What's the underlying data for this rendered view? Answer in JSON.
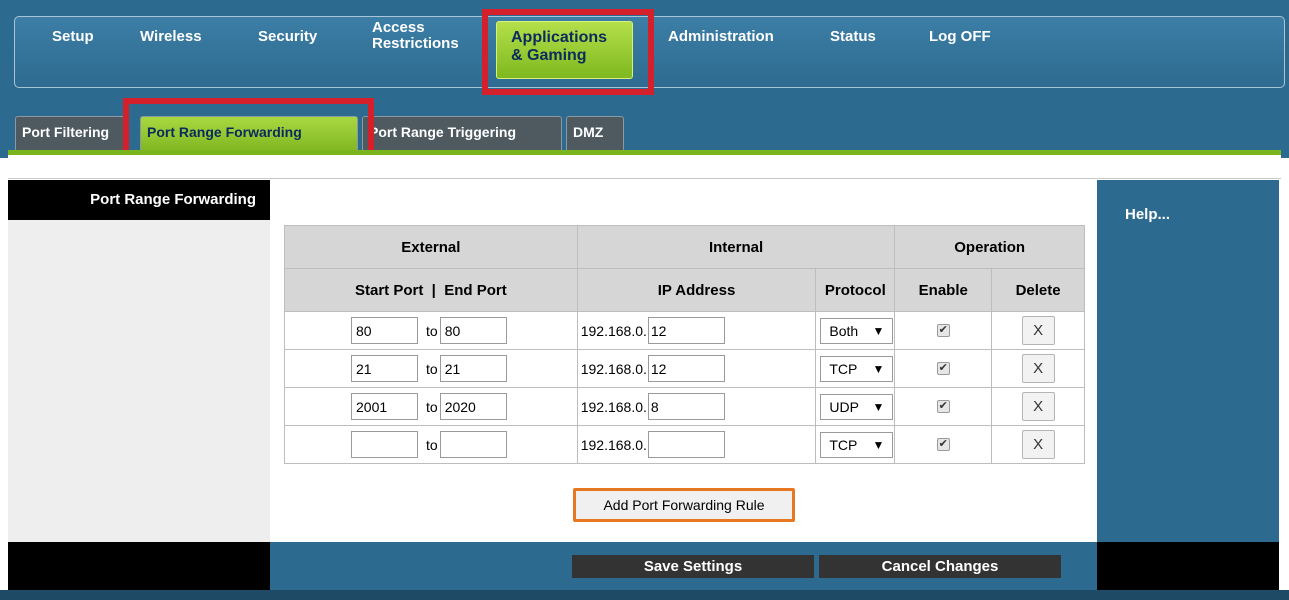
{
  "nav": {
    "items": [
      {
        "label": "Setup"
      },
      {
        "label": "Wireless"
      },
      {
        "label": "Security"
      },
      {
        "label_line1": "Access",
        "label_line2": "Restrictions"
      },
      {
        "label_line1": "Applications",
        "label_line2": "& Gaming",
        "active": true
      },
      {
        "label": "Administration"
      },
      {
        "label": "Status"
      },
      {
        "label": "Log OFF"
      }
    ]
  },
  "subtabs": [
    {
      "label": "Port Filtering"
    },
    {
      "label": "Port Range Forwarding",
      "active": true
    },
    {
      "label": "Port Range Triggering"
    },
    {
      "label": "DMZ"
    }
  ],
  "sidebar": {
    "title": "Port Range Forwarding"
  },
  "help": {
    "label": "Help..."
  },
  "table": {
    "group_headers": [
      "External",
      "Internal",
      "Operation"
    ],
    "col_headers": {
      "ports": "Start Port  |  End Port",
      "ip": "IP Address",
      "protocol": "Protocol",
      "enable": "Enable",
      "delete": "Delete"
    },
    "to_label": "to",
    "ip_prefix": "192.168.0.",
    "rows": [
      {
        "start": "80",
        "end": "80",
        "ip_last": "12",
        "protocol": "Both",
        "enabled": true,
        "delete": "X"
      },
      {
        "start": "21",
        "end": "21",
        "ip_last": "12",
        "protocol": "TCP",
        "enabled": true,
        "delete": "X"
      },
      {
        "start": "2001",
        "end": "2020",
        "ip_last": "8",
        "protocol": "UDP",
        "enabled": true,
        "delete": "X"
      },
      {
        "start": "",
        "end": "",
        "ip_last": "",
        "protocol": "TCP",
        "enabled": true,
        "delete": "X"
      }
    ]
  },
  "actions": {
    "add_rule": "Add Port Forwarding Rule",
    "save": "Save Settings",
    "cancel": "Cancel Changes"
  },
  "glyphs": {
    "dropdown_arrow": "▼",
    "checkmark": "✔"
  },
  "colors": {
    "header_blue": "#2c6a8f",
    "active_green": "#8cc425",
    "highlight_red": "#d4202a",
    "add_button_border": "#e87722"
  }
}
